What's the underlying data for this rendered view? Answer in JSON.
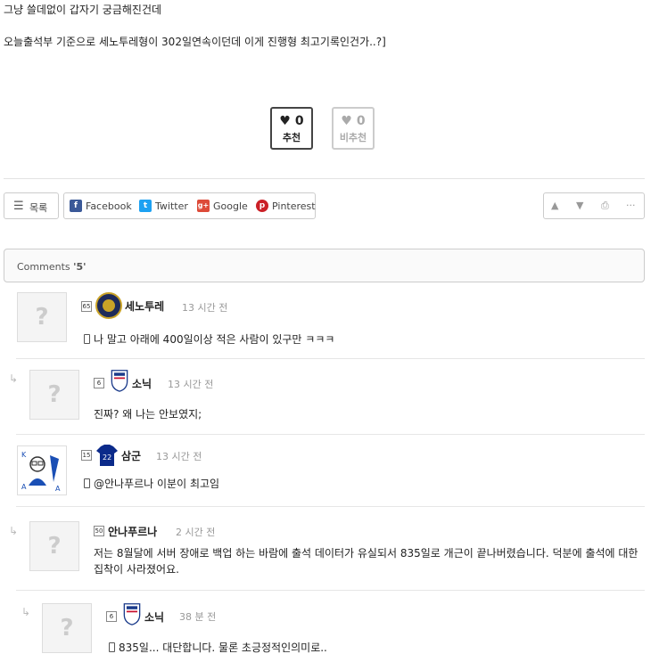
{
  "post": {
    "line1": "그냥 쓸데없이 갑자기 궁금해진건데",
    "line2": "오늘출석부 기준으로 세노투레형이 302일연속이던데 이게 진행형 최고기록인건가..?]"
  },
  "votes": {
    "up_count": "0",
    "up_label": "추천",
    "down_count": "0",
    "down_label": "비추천"
  },
  "toolbar": {
    "list_label": "목록",
    "share": [
      {
        "name": "Facebook",
        "icon": "facebook-icon",
        "color": "#3b5998",
        "glyph": "f"
      },
      {
        "name": "Twitter",
        "icon": "twitter-icon",
        "color": "#1da1f2",
        "glyph": "t"
      },
      {
        "name": "Google",
        "icon": "google-plus-icon",
        "color": "#dd4b39",
        "glyph": "g+"
      },
      {
        "name": "Pinterest",
        "icon": "pinterest-icon",
        "color": "#cb2027",
        "glyph": "p"
      }
    ],
    "nav_icons": [
      "arrow-up-icon",
      "arrow-down-icon",
      "print-icon",
      "more-icon"
    ]
  },
  "comments_header": {
    "label": "Comments",
    "count": "'5'"
  },
  "comments": [
    {
      "author": "세노투레",
      "level": "65",
      "time": "13 시간 전",
      "text": "나 말고 아래에 400일이상 적은 사람이 있구만 ㅋㅋㅋ",
      "mobile": true
    },
    {
      "author": "소닉",
      "level": "6",
      "time": "13 시간 전",
      "text": "진짜? 왜 나는 안보였지;",
      "mobile": false
    },
    {
      "author": "삼군",
      "level": "15",
      "time": "13 시간 전",
      "text": "@안나푸르나 이분이 최고임",
      "mobile": true
    },
    {
      "author": "안나푸르나",
      "level": "50",
      "time": "2 시간 전",
      "text": "저는 8월달에 서버 장애로 백업 하는 바람에 출석 데이터가 유실되서 835일로 개근이 끝나버렸습니다. 덕분에 출석에 대한 집착이 사라졌어요.",
      "mobile": false
    },
    {
      "author": "소닉",
      "level": "6",
      "time": "38 분 전",
      "text": "835일... 대단합니다. 물론 초긍정적인의미로..",
      "mobile": true
    }
  ],
  "colors": {
    "accent_border": "#444444",
    "muted": "#999999"
  }
}
